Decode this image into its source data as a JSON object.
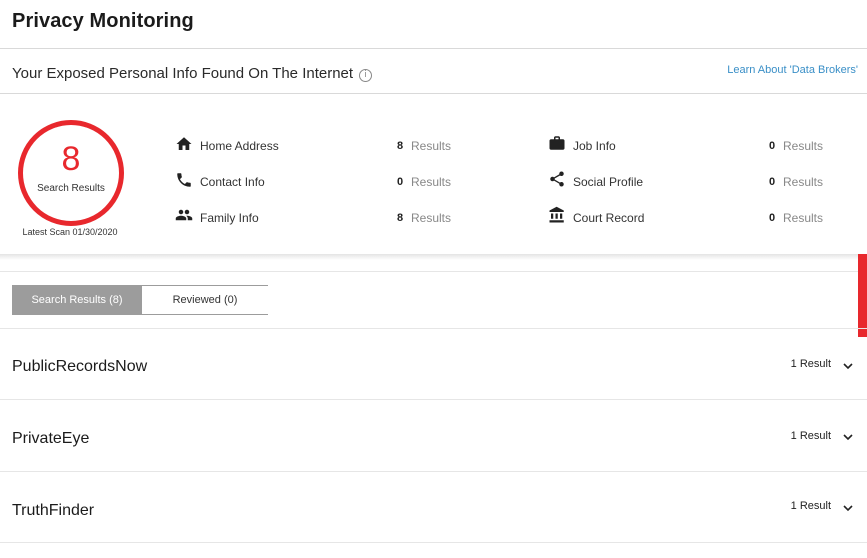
{
  "page": {
    "title": "Privacy Monitoring",
    "section_heading": "Your Exposed Personal Info Found On The Internet",
    "learn_link": "Learn About 'Data Brokers'"
  },
  "summary": {
    "total_count": "8",
    "total_label": "Search Results",
    "latest_scan": "Latest Scan 01/30/2020",
    "accent_color": "#e8282d",
    "categories": [
      {
        "label": "Home Address",
        "count": "8",
        "unit": "Results",
        "icon": "home-icon"
      },
      {
        "label": "Contact Info",
        "count": "0",
        "unit": "Results",
        "icon": "phone-icon"
      },
      {
        "label": "Family Info",
        "count": "8",
        "unit": "Results",
        "icon": "people-icon"
      },
      {
        "label": "Job Info",
        "count": "0",
        "unit": "Results",
        "icon": "briefcase-icon"
      },
      {
        "label": "Social Profile",
        "count": "0",
        "unit": "Results",
        "icon": "share-icon"
      },
      {
        "label": "Court Record",
        "count": "0",
        "unit": "Results",
        "icon": "courthouse-icon"
      }
    ]
  },
  "tabs": [
    {
      "label": "Search Results (8)",
      "active": true
    },
    {
      "label": "Reviewed (0)",
      "active": false
    }
  ],
  "results": [
    {
      "name": "PublicRecordsNow",
      "count": "1 Result"
    },
    {
      "name": "PrivateEye",
      "count": "1 Result"
    },
    {
      "name": "TruthFinder",
      "count": "1 Result"
    }
  ]
}
